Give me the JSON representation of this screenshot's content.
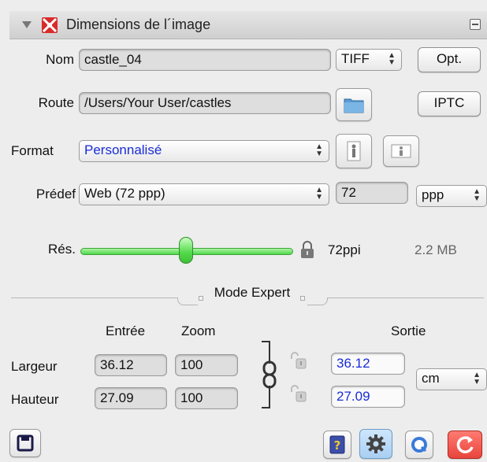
{
  "panel": {
    "title": "Dimensions de l´image"
  },
  "name_row": {
    "label": "Nom",
    "value": "castle_04",
    "format_popup": "TIFF",
    "opt_button": "Opt."
  },
  "route_row": {
    "label": "Route",
    "value": "/Users/Your User/castles",
    "iptc_button": "IPTC"
  },
  "format_row": {
    "label": "Format",
    "value": "Personnalisé"
  },
  "preset_row": {
    "label": "Prédef",
    "value": "Web (72 ppp)",
    "resolution_value": "72",
    "unit": "ppp"
  },
  "resolution_row": {
    "label": "Rés.",
    "slider_fraction": 0.5,
    "ppi": "72ppi",
    "size": "2.2 MB"
  },
  "expert": {
    "title": "Mode Expert",
    "input_header": "Entrée",
    "zoom_header": "Zoom",
    "output_header": "Sortie",
    "width_label": "Largeur",
    "height_label": "Hauteur",
    "width_in": "36.12",
    "width_zoom": "100",
    "width_out": "36.12",
    "height_in": "27.09",
    "height_zoom": "100",
    "height_out": "27.09",
    "unit": "cm"
  },
  "colors": {
    "accent_text": "#1a2cd6",
    "slider_green": "#4fd84a",
    "refresh_red": "#e8453c"
  }
}
